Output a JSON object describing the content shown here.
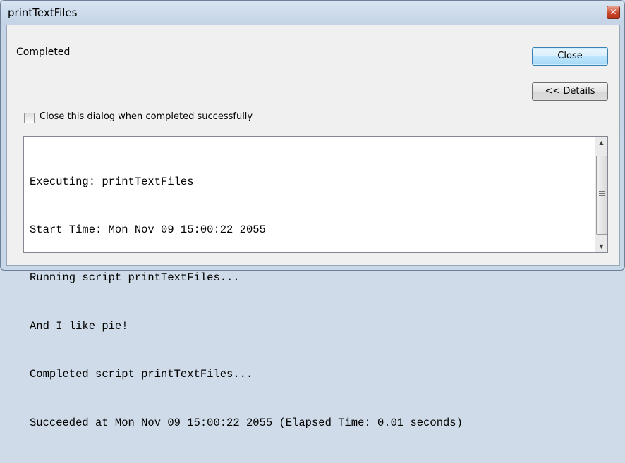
{
  "window": {
    "title": "printTextFiles"
  },
  "status": {
    "text": "Completed"
  },
  "buttons": {
    "close_label": "Close",
    "details_label": "<< Details"
  },
  "option": {
    "close_when_done_label": "Close this dialog when completed successfully",
    "checked": false
  },
  "log": {
    "lines": [
      "Executing: printTextFiles",
      "Start Time: Mon Nov 09 15:00:22 2055",
      "Running script printTextFiles...",
      "And I like pie!",
      "Completed script printTextFiles...",
      "Succeeded at Mon Nov 09 15:00:22 2055 (Elapsed Time: 0.01 seconds)"
    ]
  },
  "icons": {
    "window_close": "close-icon",
    "scroll_up": "chevron-up-icon",
    "scroll_down": "chevron-down-icon"
  }
}
